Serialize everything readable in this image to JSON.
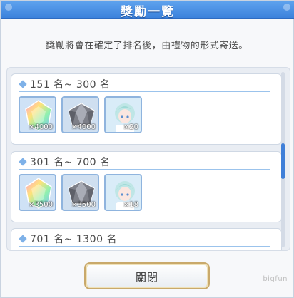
{
  "dialog": {
    "title": "獎勵一覽",
    "description": "獎勵將會在確定了排名後，由禮物的形式寄送。",
    "close_label": "關閉",
    "watermark": "bigfun"
  },
  "tiers": [
    {
      "label": "151 名~ 300 名",
      "rewards": [
        {
          "icon": "rainbow-gem-icon",
          "count": "×4000"
        },
        {
          "icon": "dark-gem-icon",
          "count": "×4000"
        },
        {
          "icon": "character-portrait-icon",
          "count": "×20"
        }
      ]
    },
    {
      "label": "301 名~ 700 名",
      "rewards": [
        {
          "icon": "rainbow-gem-icon",
          "count": "×3500"
        },
        {
          "icon": "dark-gem-icon",
          "count": "×3500"
        },
        {
          "icon": "character-portrait-icon",
          "count": "×18"
        }
      ]
    },
    {
      "label": "701 名~ 1300 名",
      "rewards": []
    }
  ],
  "colors": {
    "title_bar": "#3c82dc",
    "accent": "#7eb1e8",
    "scroll_thumb": "#3f7fd8",
    "button_border": "#c9a96b"
  }
}
